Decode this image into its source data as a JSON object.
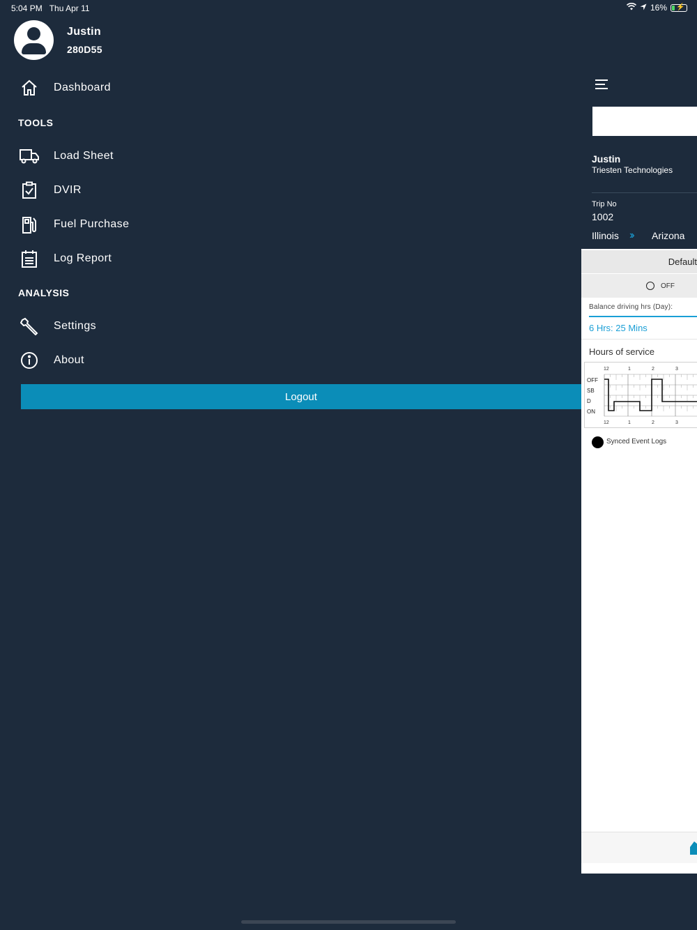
{
  "status_bar": {
    "time": "5:04 PM",
    "date": "Thu Apr 11",
    "battery": "16%",
    "battery_level": 0.16
  },
  "profile": {
    "name": "Justin",
    "code": "280D55"
  },
  "drawer": {
    "dashboard": "Dashboard",
    "tools_heading": "TOOLS",
    "tools": [
      {
        "label": "Load Sheet",
        "icon": "truck-icon"
      },
      {
        "label": "DVIR",
        "icon": "clipboard-check-icon"
      },
      {
        "label": "Fuel Purchase",
        "icon": "fuel-pump-icon"
      },
      {
        "label": "Log Report",
        "icon": "calendar-list-icon"
      }
    ],
    "analysis_heading": "ANALYSIS",
    "analysis": [
      {
        "label": "Settings",
        "icon": "wrench-icon"
      },
      {
        "label": "About",
        "icon": "info-icon"
      }
    ],
    "logout": "Logout"
  },
  "main": {
    "driver_name": "Justin",
    "company": "Triesten Technologies",
    "trip_label": "Trip No",
    "trip_no": "1002",
    "from": "Illinois",
    "to": "Arizona",
    "default_label": "Default",
    "status": "OFF",
    "balance_label": "Balance driving hrs (Day):",
    "balance_value": "6 Hrs: 25 Mins",
    "hos_title": "Hours of service",
    "graph": {
      "hours": [
        "12",
        "1",
        "2",
        "3"
      ],
      "rows": [
        "OFF",
        "SB",
        "D",
        "ON"
      ]
    },
    "legend": "Synced Event Logs"
  },
  "colors": {
    "background": "#1d2b3c",
    "accent": "#0b8db8",
    "link": "#1a9fd6"
  }
}
